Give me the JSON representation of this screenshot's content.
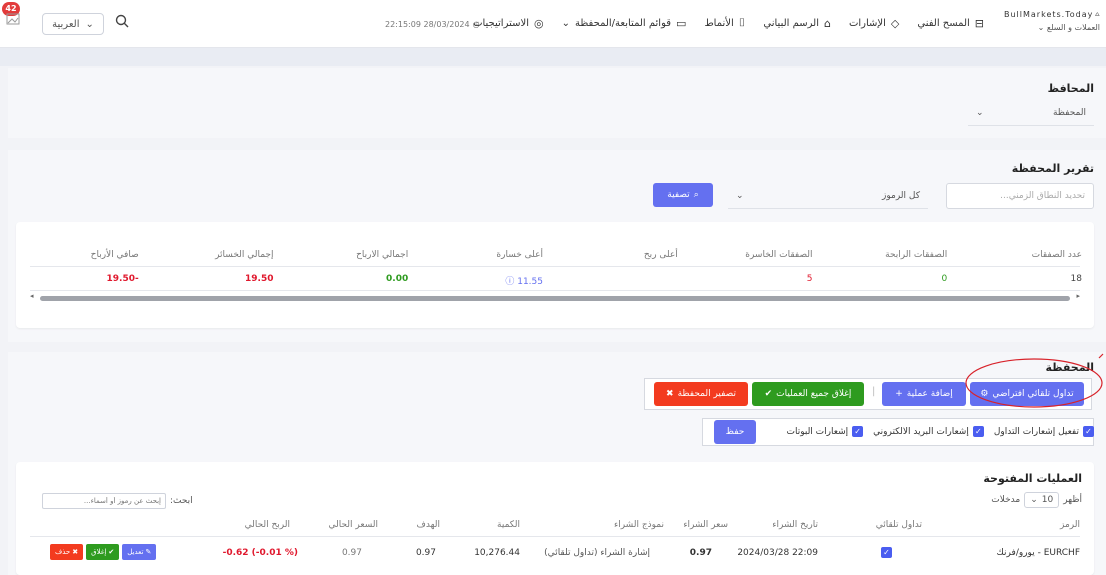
{
  "nav": {
    "badge": "42",
    "lang": "العربية",
    "time": "22:15:09 28/03/2024",
    "menu": [
      {
        "label": "الاستراتيجيات",
        "icon": "◎"
      },
      {
        "label": "قوائم المتابعة/المحفظة",
        "icon": "▭"
      },
      {
        "label": "الأنماط",
        "icon": "⌷"
      },
      {
        "label": "الرسم البياني",
        "icon": "⌂"
      },
      {
        "label": "الإشارات",
        "icon": "◇"
      },
      {
        "label": "المسح الفني",
        "icon": "⊟"
      }
    ],
    "brand": "BullMarkets.Today",
    "brand_sub": "العملات و السلع"
  },
  "portfolios": {
    "title": "المحافظ",
    "select": "المحفظة"
  },
  "report": {
    "title": "تقرير المحفظة",
    "date_placeholder": "تحديد النطاق الزمني...",
    "symbols_select": "كل الرموز",
    "filter_btn": "تصفية",
    "headers": [
      "عدد الصفقات",
      "الصفقات الرابحة",
      "الصفقات الخاسرة",
      "أعلى ربح",
      "أعلى خسارة",
      "اجمالي الارباح",
      "إجمالي الخسائر",
      "صافي الأرباح"
    ],
    "values": [
      "18",
      "0",
      "5",
      "",
      "11.55",
      "0.00",
      "19.50",
      "-19.50"
    ]
  },
  "portfolio": {
    "title": "المحفظة",
    "auto_trade_btn": "تداول تلقائي افتراضي",
    "add_btn": "إضافة عملية",
    "close_all_btn": "إغلاق جميع العمليات",
    "reset_btn": "تصفير المحفظة",
    "checks": [
      "تفعيل إشعارات التداول",
      "إشعارات البريد الالكتروني",
      "إشعارات البوتات"
    ],
    "save_btn": "حفظ"
  },
  "open_trades": {
    "title": "العمليات المفتوحة",
    "show_label": "أظهر",
    "entries_label": "مدخلات",
    "page_size": "10",
    "search_label": "ابحث:",
    "search_placeholder": "إبحث عن رموز أو أسماء...",
    "headers": [
      "الرمز",
      "تداول تلقائي",
      "تاريخ الشراء",
      "سعر الشراء",
      "نموذج الشراء",
      "الكمية",
      "الهدف",
      "السعر الحالي",
      "الربح الحالي",
      ""
    ],
    "row": {
      "symbol": "EURCHF - يورو/فرنك",
      "date": "22:09 2024/03/28",
      "buy_price": "0.97",
      "model": "إشارة الشراء (تداول تلقائي)",
      "qty": "10,276.44",
      "target": "0.97",
      "current": "0.97",
      "profit": "(% 0.01-) 0.62-",
      "edit": "تعديل",
      "close": "إغلاق",
      "delete": "حذف"
    }
  },
  "colors": {
    "accent": "#6470f0",
    "green": "#2e9b1f",
    "red": "#e0182d",
    "annot": "#d8222a"
  }
}
